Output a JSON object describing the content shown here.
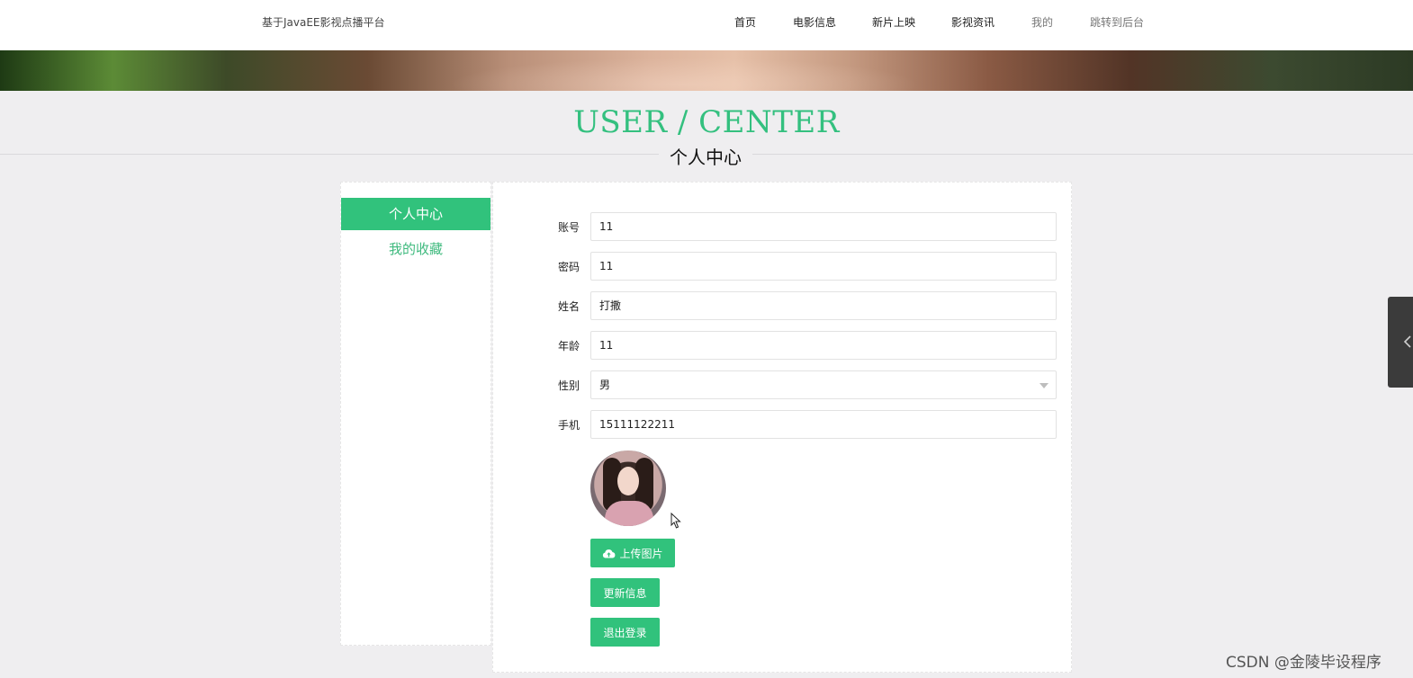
{
  "header": {
    "site_title": "基于JavaEE影视点播平台",
    "nav": [
      {
        "label": "首页"
      },
      {
        "label": "电影信息"
      },
      {
        "label": "新片上映"
      },
      {
        "label": "影视资讯"
      },
      {
        "label": "我的"
      },
      {
        "label": "跳转到后台"
      }
    ]
  },
  "section": {
    "title": "USER / CENTER",
    "subtitle": "个人中心"
  },
  "sidebar": {
    "items": [
      {
        "label": "个人中心",
        "active": true
      },
      {
        "label": "我的收藏",
        "active": false
      }
    ]
  },
  "form": {
    "account": {
      "label": "账号",
      "value": "11"
    },
    "password": {
      "label": "密码",
      "value": "11"
    },
    "name": {
      "label": "姓名",
      "value": "打撒"
    },
    "age": {
      "label": "年龄",
      "value": "11"
    },
    "gender": {
      "label": "性别",
      "value": "男"
    },
    "phone": {
      "label": "手机",
      "value": "15111122211"
    }
  },
  "buttons": {
    "upload": "上传图片",
    "update": "更新信息",
    "logout": "退出登录"
  },
  "icons": {
    "upload": "cloud-upload-icon",
    "side_tab": "chevron-left-icon",
    "cursor": "mouse-cursor-icon"
  },
  "colors": {
    "accent": "#31c27c",
    "title_green": "#34c07f",
    "background": "#efeef0"
  },
  "watermark": "CSDN @金陵毕设程序"
}
